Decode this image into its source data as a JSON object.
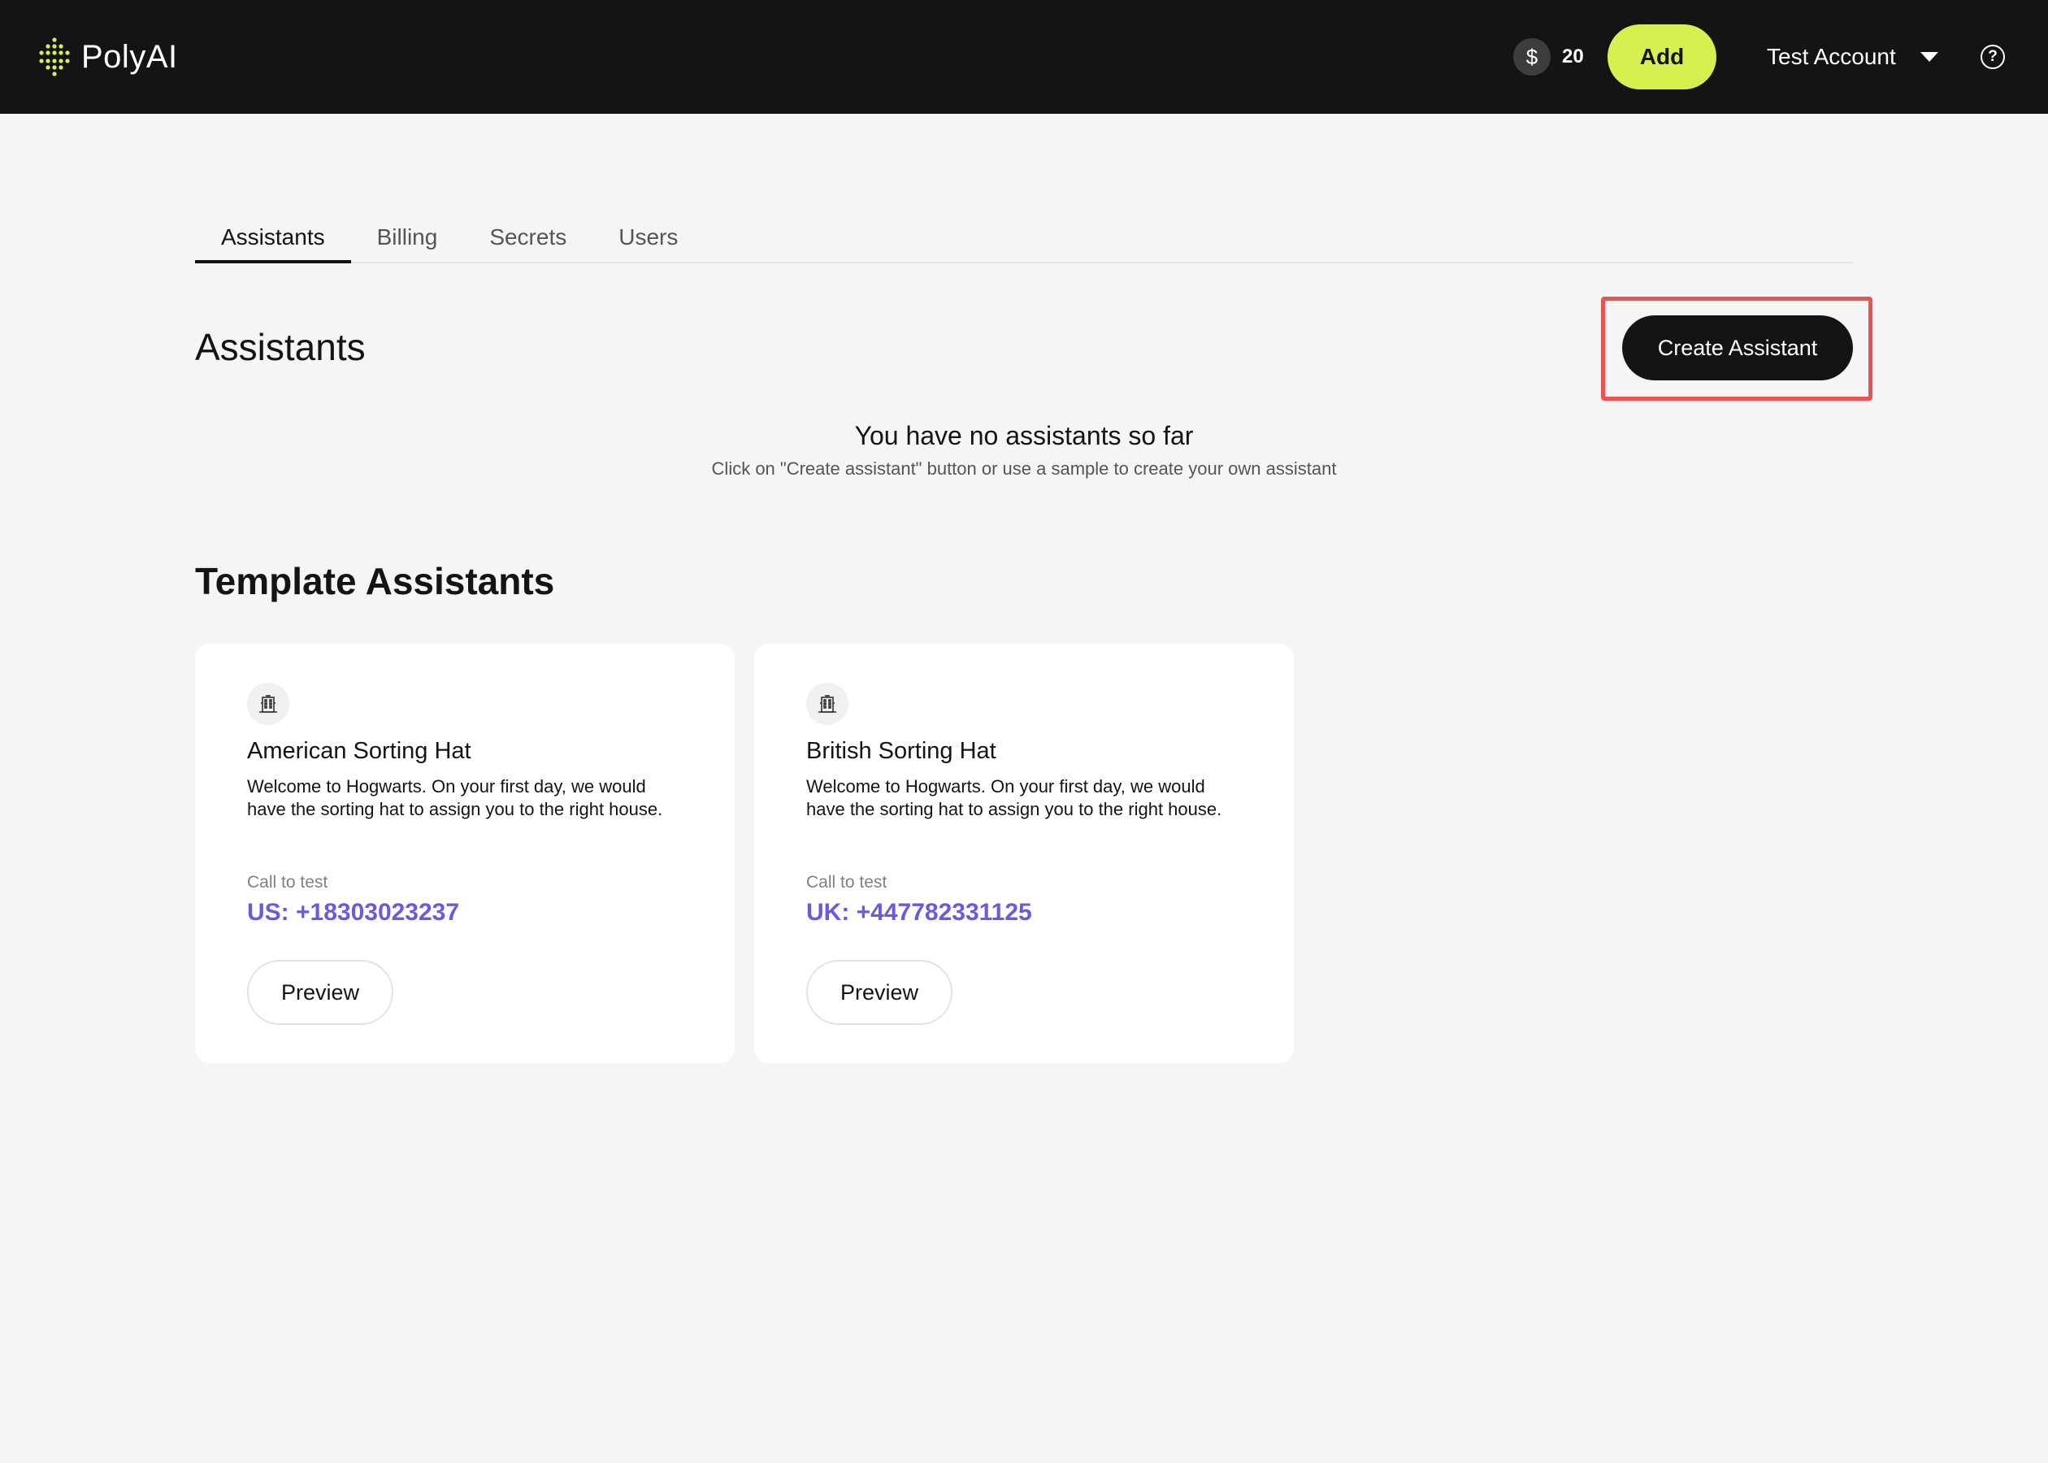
{
  "header": {
    "logo_text": "PolyAI",
    "balance_symbol": "$",
    "balance_value": "20",
    "add_label": "Add",
    "account_name": "Test Account",
    "help_symbol": "?",
    "accent_color": "#d6f04f"
  },
  "tabs": [
    {
      "label": "Assistants",
      "active": true
    },
    {
      "label": "Billing",
      "active": false
    },
    {
      "label": "Secrets",
      "active": false
    },
    {
      "label": "Users",
      "active": false
    }
  ],
  "assistants": {
    "title": "Assistants",
    "create_label": "Create Assistant",
    "empty_title": "You have no assistants so far",
    "empty_subtitle": "Click on \"Create assistant\" button or use a sample to create your own assistant"
  },
  "templates": {
    "title": "Template Assistants",
    "cards": [
      {
        "icon": "building-icon",
        "title": "American Sorting Hat",
        "description": "Welcome to Hogwarts. On your first day, we would have the sorting hat to assign you to the right house.",
        "call_label": "Call to test",
        "phone": "US: +18303023237",
        "preview_label": "Preview"
      },
      {
        "icon": "building-icon",
        "title": "British Sorting Hat",
        "description": "Welcome to Hogwarts. On your first day, we would have the sorting hat to assign you to the right house.",
        "call_label": "Call to test",
        "phone": "UK: +447782331125",
        "preview_label": "Preview"
      }
    ]
  },
  "colors": {
    "link": "#6a5ae0",
    "highlight": "#ef5151",
    "dark": "#141414"
  }
}
